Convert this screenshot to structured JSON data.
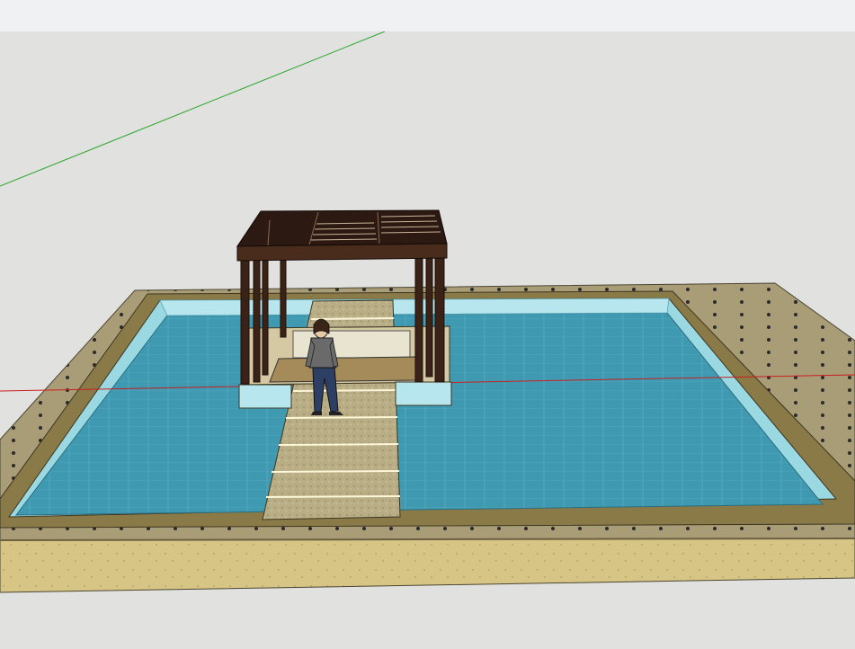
{
  "app": {
    "toolbar": {
      "background": "#f0f1f3"
    },
    "viewport": {
      "background": "#e1e1df"
    }
  },
  "scene": {
    "axes": {
      "green_axis": "#2aa52a",
      "red_axis": "#c81e1e"
    },
    "colors": {
      "water": "#3f9ab1",
      "water_edge": "#9ad8e2",
      "coping": "#8a7a48",
      "paving": "#a99d78",
      "sand": "#d6c585",
      "pergola_wood": "#3b2216",
      "path_stone": "#b8ad84",
      "person_shirt": "#6a6a6a",
      "person_jeans": "#2e3f66"
    }
  }
}
